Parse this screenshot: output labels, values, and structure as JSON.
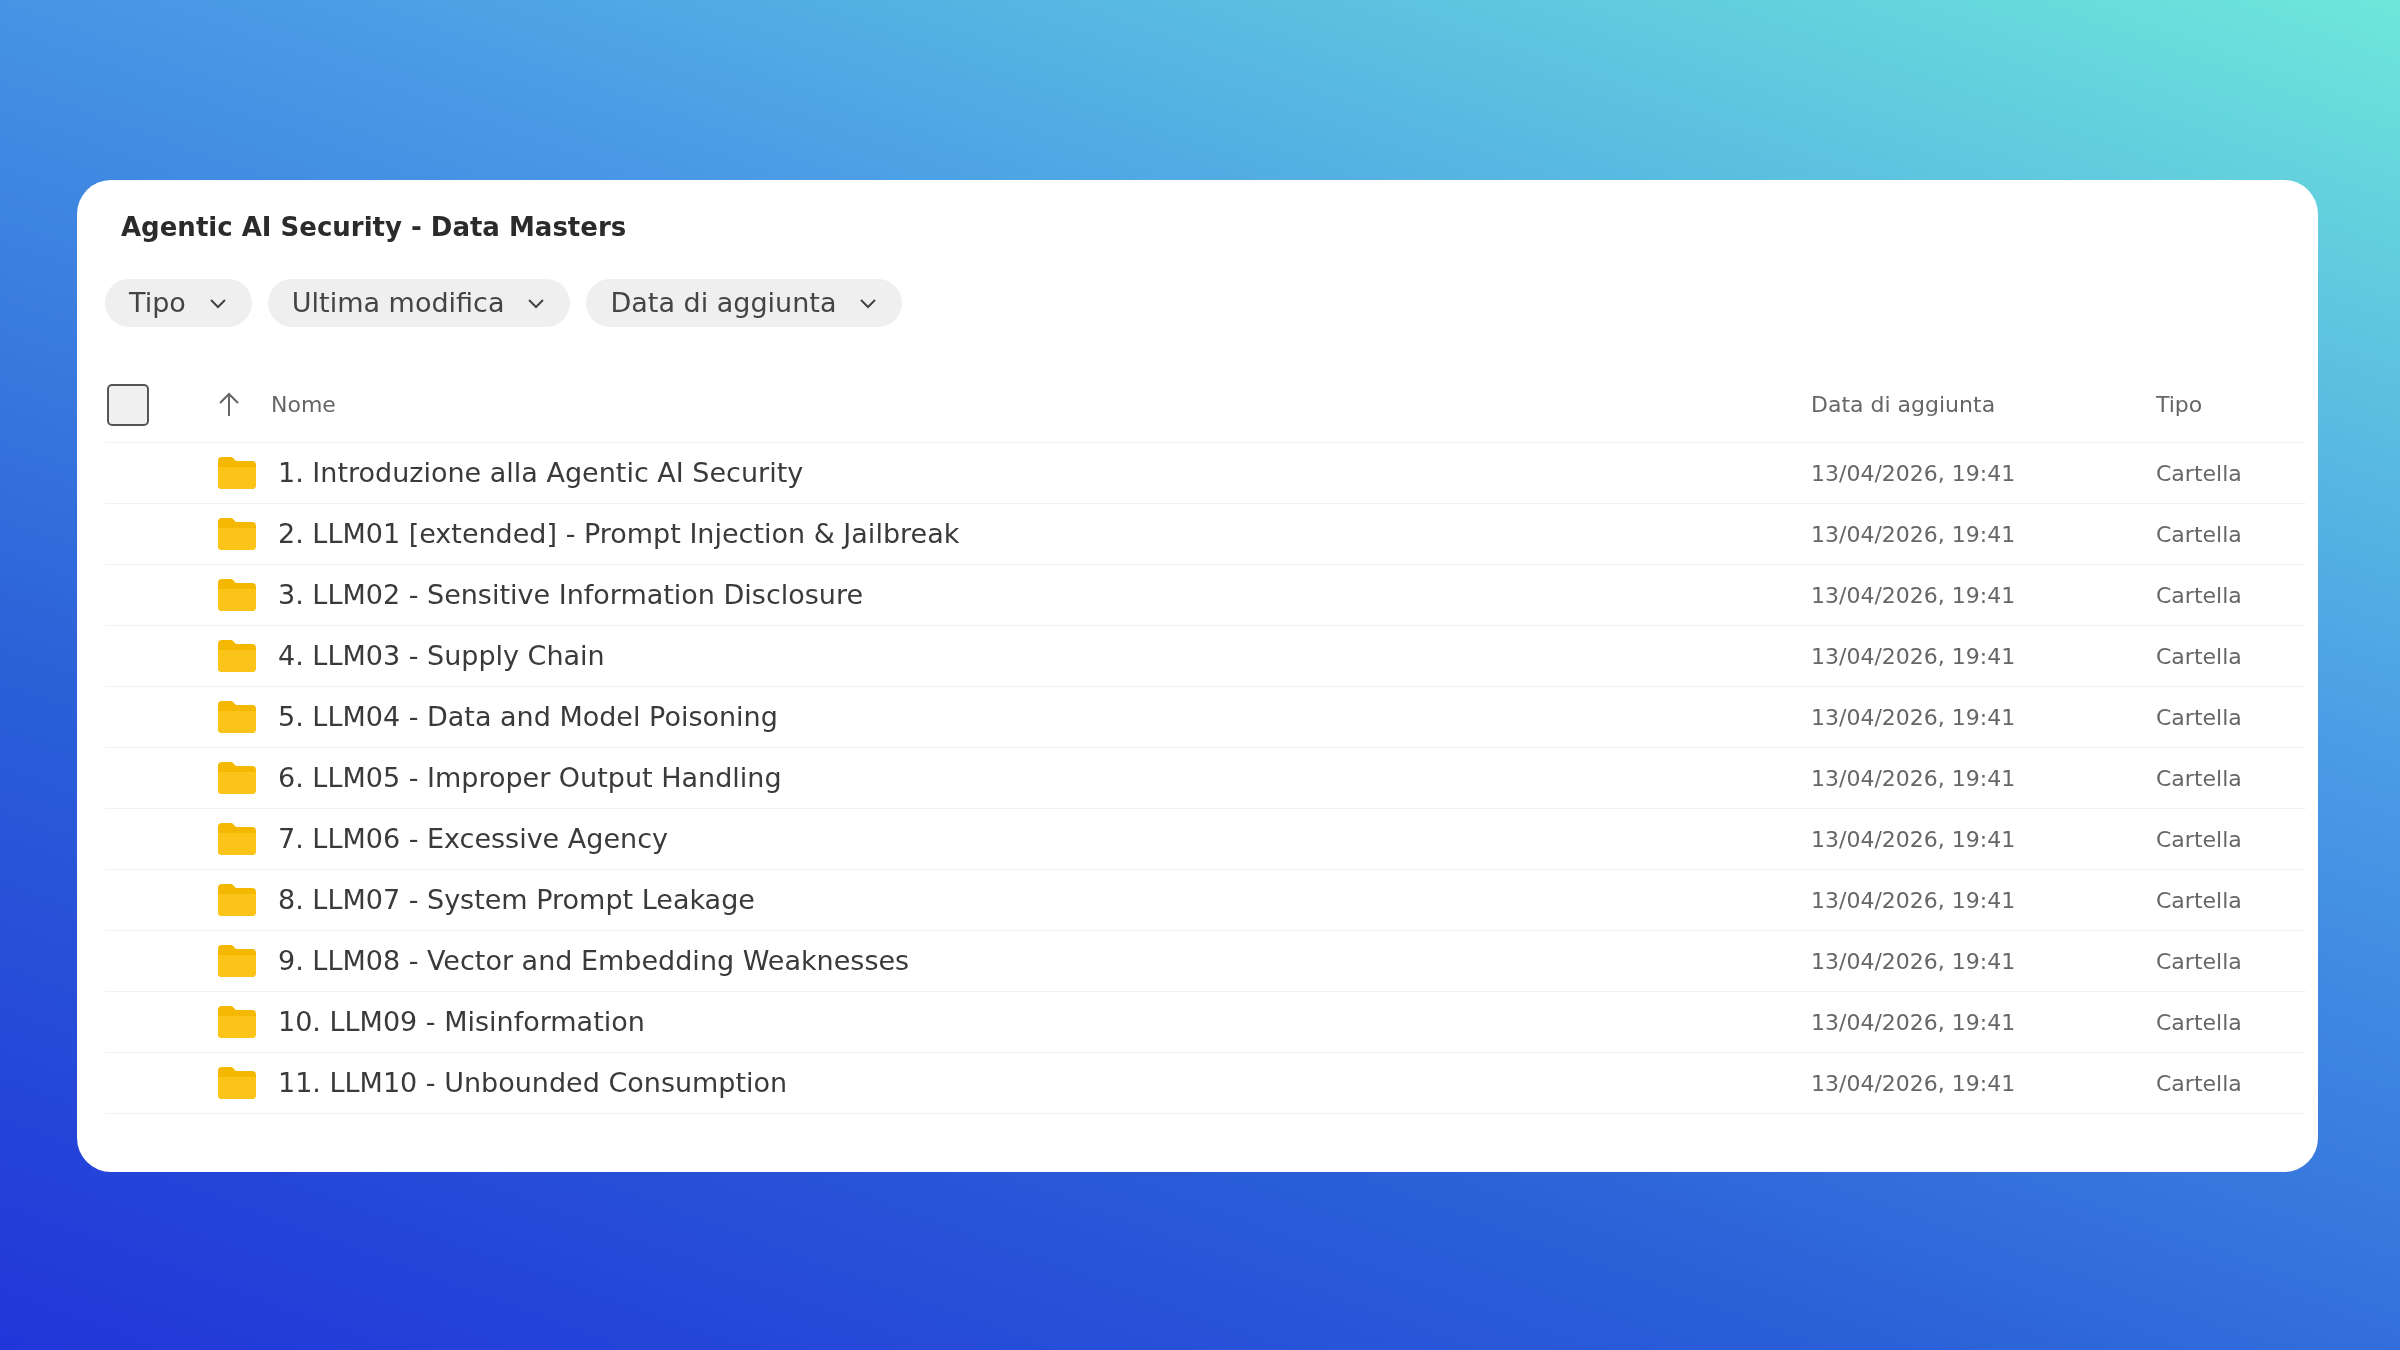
{
  "window": {
    "title": "Agentic AI Security - Data Masters"
  },
  "filters": [
    {
      "label": "Tipo"
    },
    {
      "label": "Ultima modifica"
    },
    {
      "label": "Data di aggiunta"
    }
  ],
  "table": {
    "select_all": {
      "checked": false
    },
    "columns": [
      {
        "label": "Nome",
        "sort_ascending": true
      },
      {
        "label": "Data di aggiunta"
      },
      {
        "label": "Tipo"
      }
    ],
    "rows": [
      {
        "kind": "folder",
        "name": "1. Introduzione alla Agentic AI Security",
        "added": "13/04/2026, 19:41",
        "type": "Cartella"
      },
      {
        "kind": "folder",
        "name": "2. LLM01 [extended] - Prompt Injection & Jailbreak",
        "added": "13/04/2026, 19:41",
        "type": "Cartella"
      },
      {
        "kind": "folder",
        "name": "3. LLM02 - Sensitive Information Disclosure",
        "added": "13/04/2026, 19:41",
        "type": "Cartella"
      },
      {
        "kind": "folder",
        "name": "4. LLM03 - Supply Chain",
        "added": "13/04/2026, 19:41",
        "type": "Cartella"
      },
      {
        "kind": "folder",
        "name": "5. LLM04 - Data and Model Poisoning",
        "added": "13/04/2026, 19:41",
        "type": "Cartella"
      },
      {
        "kind": "folder",
        "name": "6. LLM05 - Improper Output Handling",
        "added": "13/04/2026, 19:41",
        "type": "Cartella"
      },
      {
        "kind": "folder",
        "name": "7. LLM06 - Excessive Agency",
        "added": "13/04/2026, 19:41",
        "type": "Cartella"
      },
      {
        "kind": "folder",
        "name": "8. LLM07 - System Prompt Leakage",
        "added": "13/04/2026, 19:41",
        "type": "Cartella"
      },
      {
        "kind": "folder",
        "name": "9. LLM08 - Vector and Embedding Weaknesses",
        "added": "13/04/2026, 19:41",
        "type": "Cartella"
      },
      {
        "kind": "folder",
        "name": "10. LLM09 - Misinformation",
        "added": "13/04/2026, 19:41",
        "type": "Cartella"
      },
      {
        "kind": "folder",
        "name": "11. LLM10 - Unbounded Consumption",
        "added": "13/04/2026, 19:41",
        "type": "Cartella"
      }
    ]
  }
}
